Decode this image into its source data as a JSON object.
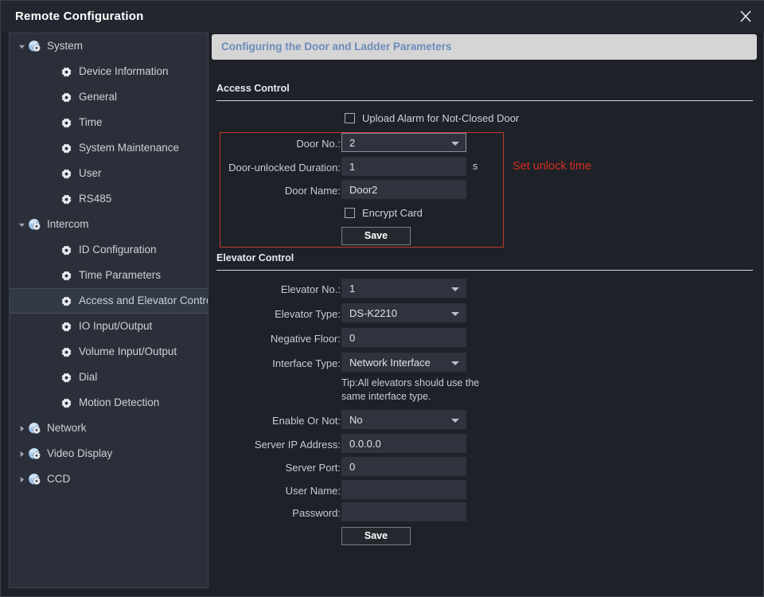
{
  "window": {
    "title": "Remote Configuration",
    "close_icon": "close-icon"
  },
  "sidebar": {
    "items": [
      {
        "label": "System",
        "level": 0,
        "twisty": "expanded",
        "icon": "globe-gear-icon",
        "selected": false
      },
      {
        "label": "Device Information",
        "level": 1,
        "twisty": "none",
        "icon": "gear-icon",
        "selected": false
      },
      {
        "label": "General",
        "level": 1,
        "twisty": "none",
        "icon": "gear-icon",
        "selected": false
      },
      {
        "label": "Time",
        "level": 1,
        "twisty": "none",
        "icon": "gear-icon",
        "selected": false
      },
      {
        "label": "System Maintenance",
        "level": 1,
        "twisty": "none",
        "icon": "gear-icon",
        "selected": false
      },
      {
        "label": "User",
        "level": 1,
        "twisty": "none",
        "icon": "gear-icon",
        "selected": false
      },
      {
        "label": "RS485",
        "level": 1,
        "twisty": "none",
        "icon": "gear-icon",
        "selected": false
      },
      {
        "label": "Intercom",
        "level": 0,
        "twisty": "expanded",
        "icon": "globe-gear-icon",
        "selected": false
      },
      {
        "label": "ID Configuration",
        "level": 1,
        "twisty": "none",
        "icon": "gear-icon",
        "selected": false
      },
      {
        "label": "Time Parameters",
        "level": 1,
        "twisty": "none",
        "icon": "gear-icon",
        "selected": false
      },
      {
        "label": "Access and Elevator Control",
        "level": 1,
        "twisty": "none",
        "icon": "gear-icon",
        "selected": true
      },
      {
        "label": "IO Input/Output",
        "level": 1,
        "twisty": "none",
        "icon": "gear-icon",
        "selected": false
      },
      {
        "label": "Volume Input/Output",
        "level": 1,
        "twisty": "none",
        "icon": "gear-icon",
        "selected": false
      },
      {
        "label": "Dial",
        "level": 1,
        "twisty": "none",
        "icon": "gear-icon",
        "selected": false
      },
      {
        "label": "Motion Detection",
        "level": 1,
        "twisty": "none",
        "icon": "gear-icon",
        "selected": false
      },
      {
        "label": "Network",
        "level": 0,
        "twisty": "collapsed",
        "icon": "globe-gear-icon",
        "selected": false
      },
      {
        "label": "Video Display",
        "level": 0,
        "twisty": "collapsed",
        "icon": "globe-gear-icon",
        "selected": false
      },
      {
        "label": "CCD",
        "level": 0,
        "twisty": "collapsed",
        "icon": "globe-gear-icon",
        "selected": false
      }
    ]
  },
  "banner": {
    "text": "Configuring the Door and Ladder Parameters"
  },
  "access_control": {
    "section_title": "Access Control",
    "upload_alarm_label": "Upload Alarm for Not-Closed Door",
    "upload_alarm_checked": false,
    "door_no_label": "Door No.:",
    "door_no_value": "2",
    "door_unlocked_duration_label": "Door-unlocked Duration:",
    "door_unlocked_duration_value": "1",
    "door_unlocked_duration_unit": "s",
    "door_name_label": "Door Name:",
    "door_name_value": "Door2",
    "encrypt_card_label": "Encrypt Card",
    "encrypt_card_checked": false,
    "save_label": "Save"
  },
  "annotation": {
    "text": "Set unlock time",
    "color": "#d62d20"
  },
  "elevator_control": {
    "section_title": "Elevator Control",
    "elevator_no_label": "Elevator No.:",
    "elevator_no_value": "1",
    "elevator_type_label": "Elevator Type:",
    "elevator_type_value": "DS-K2210",
    "negative_floor_label": "Negative Floor:",
    "negative_floor_value": "0",
    "interface_type_label": "Interface Type:",
    "interface_type_value": "Network Interface",
    "tip": "Tip:All elevators should use the same interface type.",
    "enable_or_not_label": "Enable Or Not:",
    "enable_or_not_value": "No",
    "server_ip_label": "Server IP Address:",
    "server_ip_value": "0.0.0.0",
    "server_port_label": "Server Port:",
    "server_port_value": "0",
    "user_name_label": "User Name:",
    "user_name_value": "",
    "password_label": "Password:",
    "password_value": "",
    "save_label": "Save"
  }
}
